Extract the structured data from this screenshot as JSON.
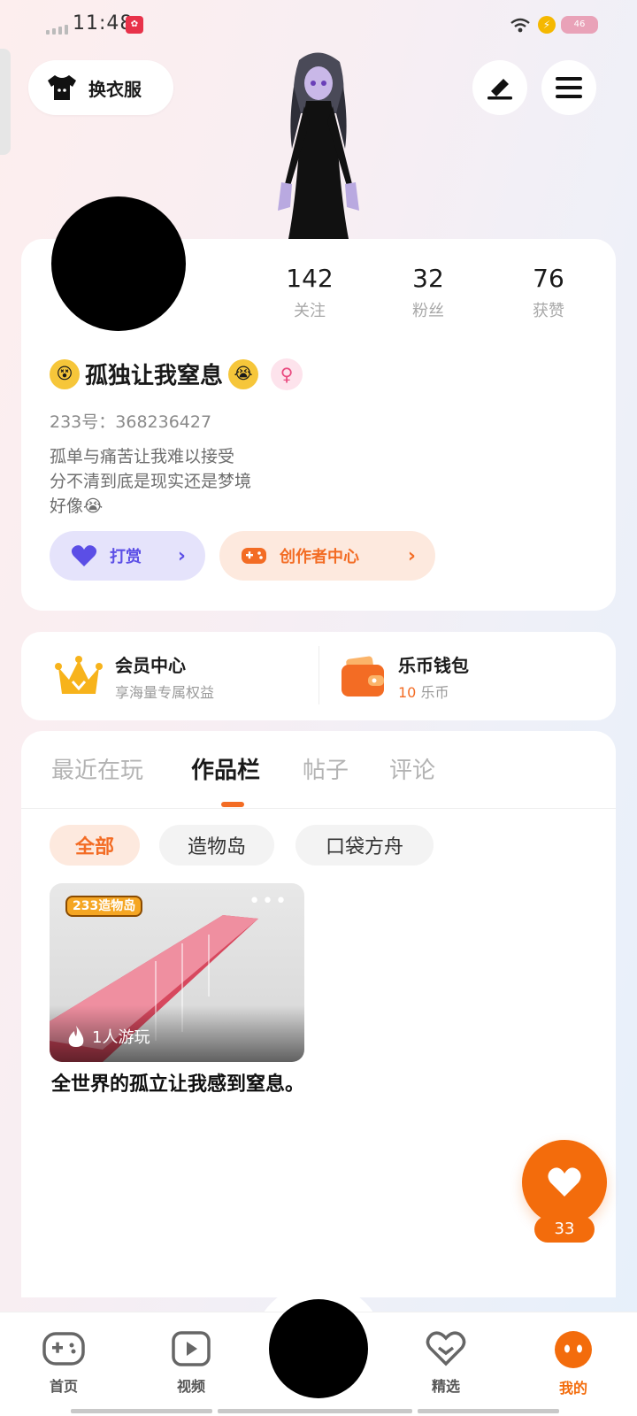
{
  "status_bar": {
    "time": "11:48",
    "battery": "46"
  },
  "top": {
    "outfit_label": "换衣服",
    "edit_icon": "pen-icon",
    "menu_icon": "hamburger-icon"
  },
  "profile": {
    "stats": [
      {
        "value": "142",
        "label": "关注"
      },
      {
        "value": "32",
        "label": "粉丝"
      },
      {
        "value": "76",
        "label": "获赞"
      }
    ],
    "nickname": "孤独让我窒息",
    "uid_label": "233号：",
    "uid": "368236427",
    "bio_lines": [
      "孤单与痛苦让我难以接受",
      "分不清到底是现实还是梦境",
      "好像"
    ],
    "btn_reward": "打赏",
    "btn_creator": "创作者中心"
  },
  "member": {
    "vip_title": "会员中心",
    "vip_sub": "享海量专属权益",
    "wallet_title": "乐币钱包",
    "wallet_amount": "10",
    "wallet_unit": "乐币"
  },
  "tabs": [
    "最近在玩",
    "作品栏",
    "帖子",
    "评论"
  ],
  "active_tab": "作品栏",
  "chips": [
    "全部",
    "造物岛",
    "口袋方舟"
  ],
  "work": {
    "logo_text": "233造物岛",
    "players": "1人游玩",
    "title": "全世界的孤立让我感到窒息。"
  },
  "like": {
    "count": "33"
  },
  "nav": [
    {
      "label": "首页",
      "icon": "gamepad-icon"
    },
    {
      "label": "视频",
      "icon": "video-icon"
    },
    {
      "label": "精选",
      "icon": "heart-box-icon"
    },
    {
      "label": "我的",
      "icon": "profile-face-icon"
    }
  ],
  "colors": {
    "accent": "#f36c24",
    "purple": "#5b4ee6",
    "fab": "#f36c0c"
  }
}
